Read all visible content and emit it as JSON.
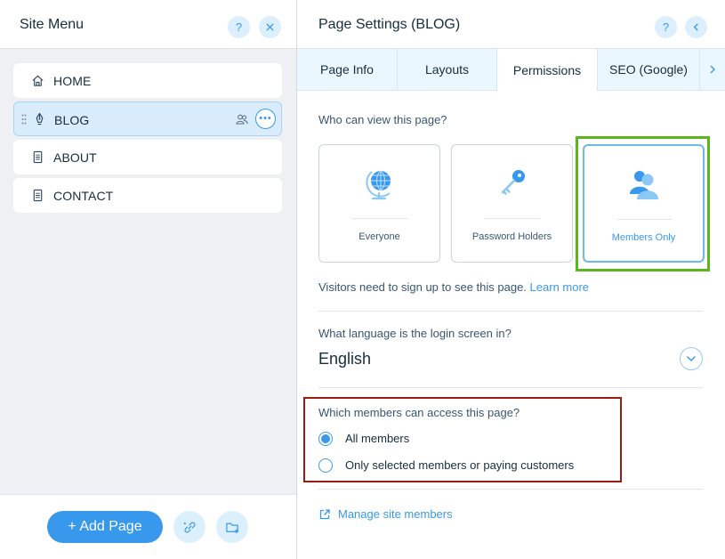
{
  "site_menu": {
    "title": "Site Menu",
    "help_icon": "question-mark-icon",
    "close_icon": "close-icon",
    "pages": [
      {
        "label": "HOME",
        "icon": "home-icon"
      },
      {
        "label": "BLOG",
        "icon": "pen-nib-icon",
        "selected": true
      },
      {
        "label": "ABOUT",
        "icon": "page-icon"
      },
      {
        "label": "CONTACT",
        "icon": "page-icon"
      }
    ],
    "add_page_label": "+ Add Page"
  },
  "page_settings": {
    "title": "Page Settings (BLOG)",
    "tabs": [
      {
        "label": "Page Info"
      },
      {
        "label": "Layouts"
      },
      {
        "label": "Permissions",
        "active": true
      },
      {
        "label": "SEO (Google)"
      }
    ],
    "who_can_view_label": "Who can view this page?",
    "permission_options": [
      {
        "label": "Everyone",
        "icon": "globe-icon"
      },
      {
        "label": "Password Holders",
        "icon": "key-icon"
      },
      {
        "label": "Members Only",
        "icon": "members-icon",
        "selected": true
      }
    ],
    "info_text": "Visitors need to sign up to see this page.",
    "learn_more": "Learn more",
    "login_language_label": "What language is the login screen in?",
    "login_language_value": "English",
    "which_members_label": "Which members can access this page?",
    "member_access_options": [
      {
        "label": "All members",
        "checked": true
      },
      {
        "label": "Only selected members or paying customers",
        "checked": false
      }
    ],
    "manage_members_label": "Manage site members"
  },
  "colors": {
    "accent": "#3899ec",
    "highlight_green": "#59b61b",
    "highlight_red": "#9c1c13"
  }
}
